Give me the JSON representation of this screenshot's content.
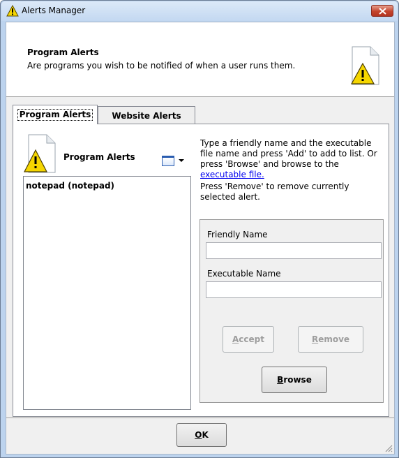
{
  "window": {
    "title": "Alerts Manager",
    "icon": "warning-icon",
    "close_icon": "close-icon"
  },
  "header": {
    "title": "Program Alerts",
    "description": "Are programs you wish to be notified of when a user runs them.",
    "icon": "document-warning-icon"
  },
  "tabs": [
    {
      "label": "Program Alerts",
      "selected": true
    },
    {
      "label": "Website Alerts",
      "selected": false
    }
  ],
  "list": {
    "heading": "Program Alerts",
    "icon": "document-warning-icon",
    "view_icon": "window-view-icon",
    "items": [
      "notepad (notepad)"
    ]
  },
  "instructions": {
    "line1_prefix": "Type a friendly name and the executable file name and press 'Add' to add to list.  Or press 'Browse' and browse to the ",
    "link": "executable file.",
    "line2": "Press 'Remove' to remove currently selected alert."
  },
  "form": {
    "friendly_label": "Friendly Name",
    "friendly_value": "",
    "executable_label": "Executable Name",
    "executable_value": "",
    "accept_first": "A",
    "accept_rest": "ccept",
    "remove_first": "R",
    "remove_rest": "emove",
    "browse_first": "B",
    "browse_rest": "rowse"
  },
  "footer": {
    "ok_first": "O",
    "ok_rest": "K"
  },
  "colors": {
    "title_bar": "#c3d8f1",
    "close_button": "#c4452d",
    "link": "#0000ee",
    "warning_yellow": "#f5d600"
  }
}
